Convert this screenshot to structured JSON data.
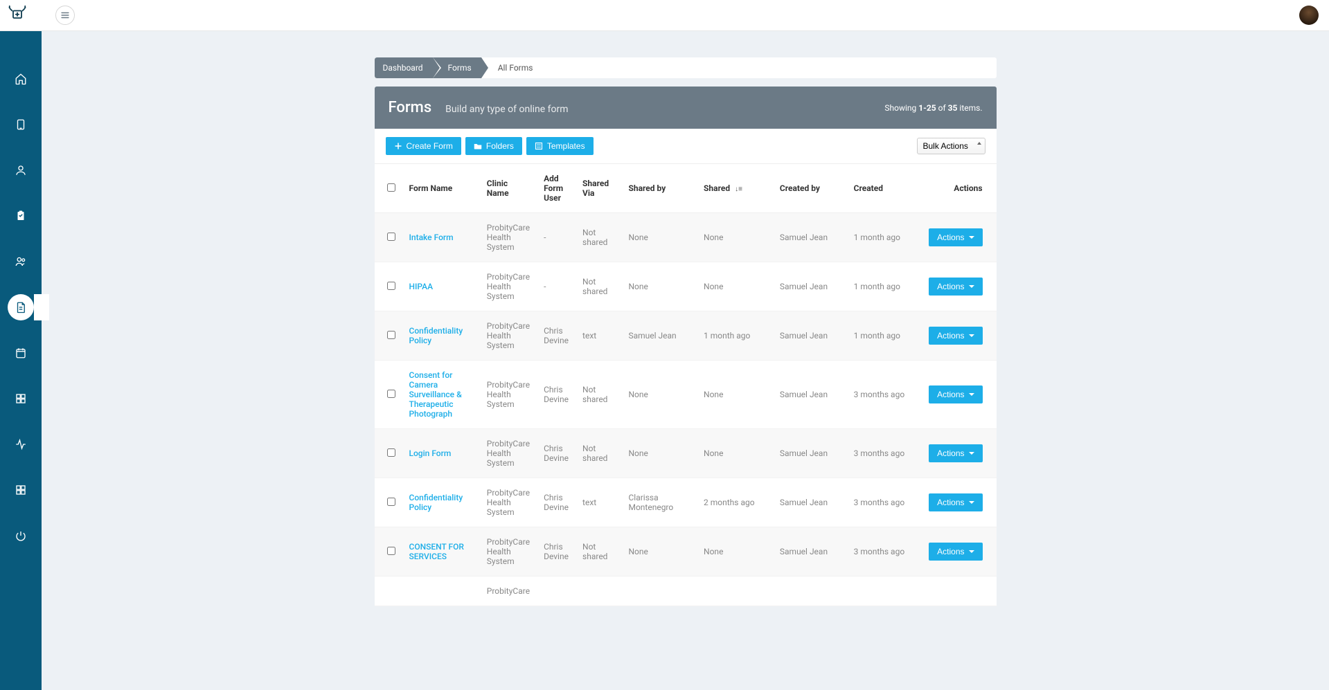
{
  "breadcrumb": {
    "items": [
      "Dashboard",
      "Forms"
    ],
    "current": "All Forms"
  },
  "header": {
    "title": "Forms",
    "subtitle": "Build any type of online form",
    "showing_prefix": "Showing",
    "range": "1-25",
    "of_label": "of",
    "total": "35",
    "items_label": "items."
  },
  "toolbar": {
    "create_label": "Create Form",
    "folders_label": "Folders",
    "templates_label": "Templates",
    "bulk_label": "Bulk Actions"
  },
  "columns": {
    "form_name": "Form Name",
    "clinic_name": "Clinic Name",
    "add_form_user": "Add Form User",
    "shared_via": "Shared Via",
    "shared_by": "Shared by",
    "shared": "Shared",
    "created_by": "Created by",
    "created": "Created",
    "actions": "Actions"
  },
  "action_button_label": "Actions",
  "rows": [
    {
      "name": "Intake Form",
      "clinic": "ProbityCare Health System",
      "add_user": "-",
      "shared_via": "Not shared",
      "shared_by": "None",
      "shared": "None",
      "created_by": "Samuel Jean",
      "created": "1 month ago"
    },
    {
      "name": "HIPAA",
      "clinic": "ProbityCare Health System",
      "add_user": "-",
      "shared_via": "Not shared",
      "shared_by": "None",
      "shared": "None",
      "created_by": "Samuel Jean",
      "created": "1 month ago"
    },
    {
      "name": "Confidentiality Policy",
      "clinic": "ProbityCare Health System",
      "add_user": "Chris Devine",
      "shared_via": "text",
      "shared_by": "Samuel Jean",
      "shared": "1 month ago",
      "created_by": "Samuel Jean",
      "created": "1 month ago"
    },
    {
      "name": "Consent for Camera Surveillance & Therapeutic Photograph",
      "clinic": "ProbityCare Health System",
      "add_user": "Chris Devine",
      "shared_via": "Not shared",
      "shared_by": "None",
      "shared": "None",
      "created_by": "Samuel Jean",
      "created": "3 months ago"
    },
    {
      "name": "Login Form",
      "clinic": "ProbityCare Health System",
      "add_user": "Chris Devine",
      "shared_via": "Not shared",
      "shared_by": "None",
      "shared": "None",
      "created_by": "Samuel Jean",
      "created": "3 months ago"
    },
    {
      "name": "Confidentiality Policy",
      "clinic": "ProbityCare Health System",
      "add_user": "Chris Devine",
      "shared_via": "text",
      "shared_by": "Clarissa Montenegro",
      "shared": "2 months ago",
      "created_by": "Samuel Jean",
      "created": "3 months ago"
    },
    {
      "name": "CONSENT FOR SERVICES",
      "clinic": "ProbityCare Health System",
      "add_user": "Chris Devine",
      "shared_via": "Not shared",
      "shared_by": "None",
      "shared": "None",
      "created_by": "Samuel Jean",
      "created": "3 months ago"
    },
    {
      "name": "",
      "clinic": "ProbityCare",
      "add_user": "",
      "shared_via": "",
      "shared_by": "",
      "shared": "",
      "created_by": "",
      "created": ""
    }
  ]
}
